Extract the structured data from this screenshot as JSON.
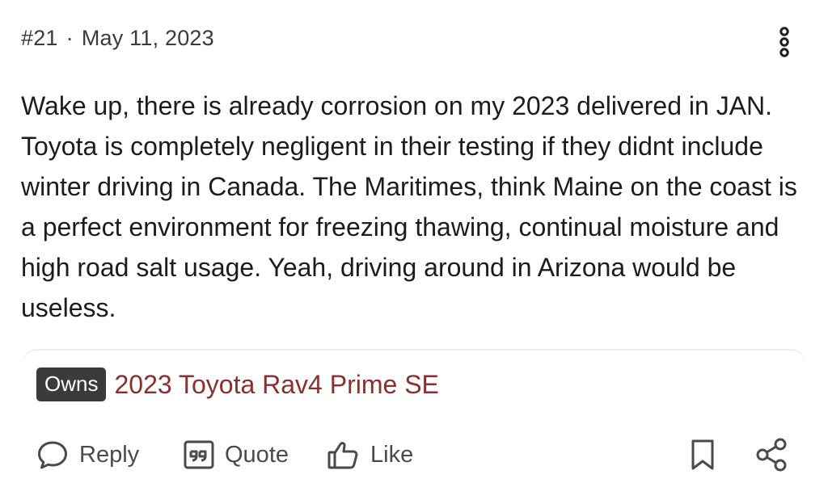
{
  "post": {
    "number": "#21",
    "separator": "·",
    "date": "May 11, 2023",
    "menu_icon": "more-vertical-icon",
    "body": "Wake up, there is already corrosion on my 2023 delivered in JAN. Toyota is completely negligent in their testing if they didnt include winter driving in Canada. The Maritimes, think Maine on the coast is a perfect environment for freezing thawing, continual moisture and high road salt usage. Yeah, driving around in Arizona would be useless."
  },
  "ownership": {
    "badge": "Owns",
    "vehicle": "2023 Toyota Rav4 Prime SE",
    "vehicle_color": "#8a2f2f",
    "badge_color": "#3b3b3b"
  },
  "actions": {
    "reply_label": "Reply",
    "reply_icon": "comment-icon",
    "quote_label": "Quote",
    "quote_icon": "quote-icon",
    "like_label": "Like",
    "like_icon": "thumbs-up-icon",
    "bookmark_icon": "bookmark-icon",
    "share_icon": "share-icon"
  }
}
